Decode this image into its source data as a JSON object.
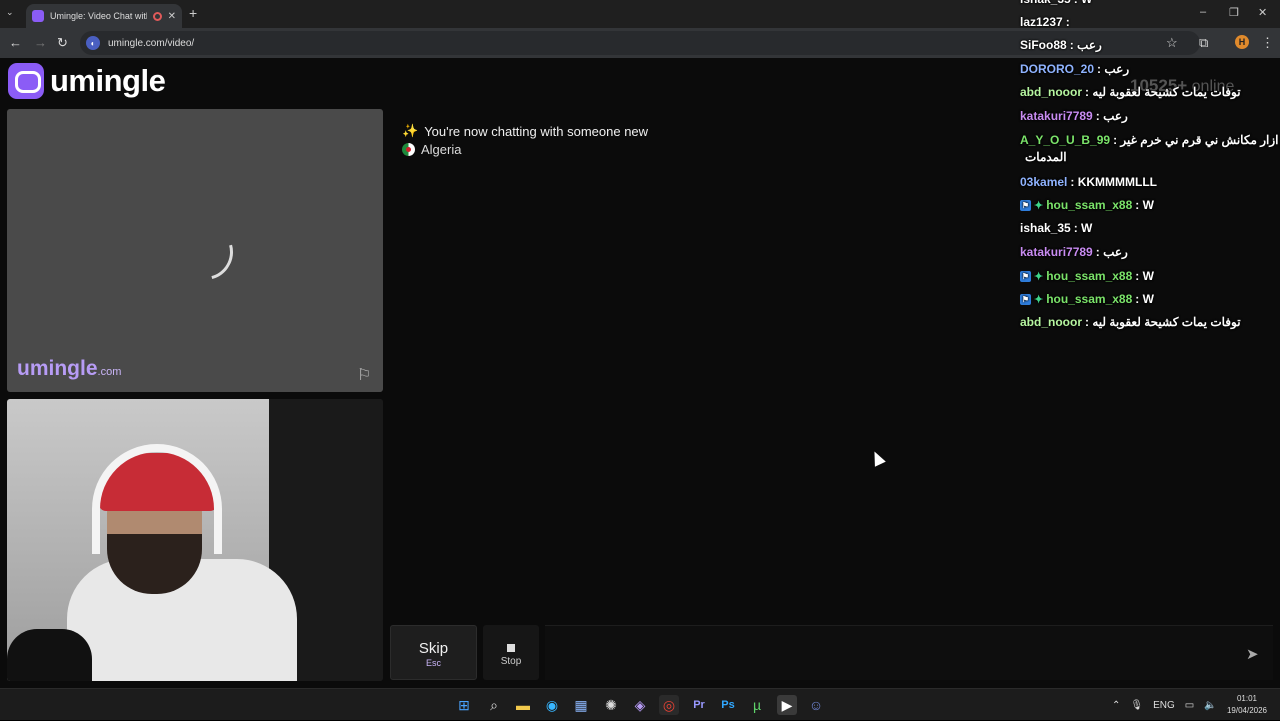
{
  "browser": {
    "tab_title": "Umingle: Video Chat with S",
    "tab_close": "✕",
    "new_tab": "+",
    "url": "umingle.com/video/",
    "window_controls": [
      "–",
      "❐",
      "✕"
    ],
    "profile_initial": "H"
  },
  "site": {
    "logo_text": "umingle",
    "online_count": "10525+",
    "online_label": "online"
  },
  "remote": {
    "watermark_main": "umingle",
    "watermark_suffix": ".com"
  },
  "chat": {
    "system_message": "You're now chatting with someone new",
    "country": "Algeria",
    "input_placeholder": ""
  },
  "controls": {
    "skip_label": "Skip",
    "skip_key": "Esc",
    "stop_label": "Stop"
  },
  "overlay_chat": [
    {
      "user": "ishak_35",
      "color": "#ffffff",
      "text": ": W",
      "badges": false
    },
    {
      "user": "laz1237",
      "color": "#ffffff",
      "text": ":",
      "badges": false
    },
    {
      "user": "SiFoo88",
      "color": "#ffffff",
      "text": ": رعب",
      "badges": false
    },
    {
      "user": "DORORO_20",
      "color": "#8fb3ff",
      "text": ": رعب",
      "badges": false
    },
    {
      "user": "abd_nooor",
      "color": "#b6f5a0",
      "text": ": توفات يمات كشيحة لعقوبة ليه",
      "badges": false
    },
    {
      "user": "katakuri7789",
      "color": "#c98cf2",
      "text": ": رعب",
      "badges": false
    },
    {
      "user": "A_Y_O_U_B_99",
      "color": "#7be36a",
      "text": ": دير ازار مكانش ني قرم ني خرم غير",
      "badges": false
    },
    {
      "user": "",
      "color": "#ffffff",
      "text": "المدمات",
      "badges": false
    },
    {
      "user": "03kamel",
      "color": "#8fb3ff",
      "text": ": KKMMMMLLL",
      "badges": false
    },
    {
      "user": "hou_ssam_x88",
      "color": "#7be36a",
      "text": ": W",
      "badges": true
    },
    {
      "user": "ishak_35",
      "color": "#ffffff",
      "text": ": W",
      "badges": false
    },
    {
      "user": "katakuri7789",
      "color": "#c98cf2",
      "text": ": رعب",
      "badges": false
    },
    {
      "user": "hou_ssam_x88",
      "color": "#7be36a",
      "text": ": W",
      "badges": true
    },
    {
      "user": "hou_ssam_x88",
      "color": "#7be36a",
      "text": ": W",
      "badges": true
    },
    {
      "user": "abd_nooor",
      "color": "#b6f5a0",
      "text": ": توفات يمات كشيحة لعقوبة ليه",
      "badges": false
    }
  ],
  "taskbar": {
    "lang": "ENG",
    "time": "01:01",
    "date": "19/04/2026"
  },
  "colors": {
    "brand": "#8b5cf6",
    "page_bg": "#0b0b0b",
    "remote_bg": "#4a4a4a"
  }
}
